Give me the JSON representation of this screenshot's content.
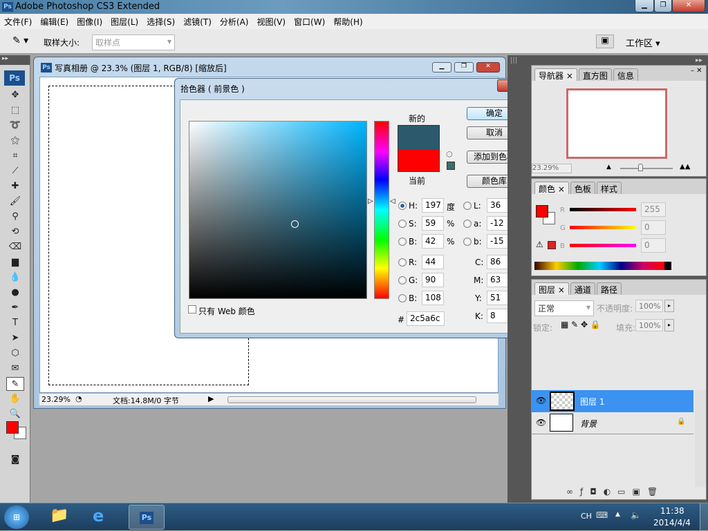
{
  "app": {
    "title": "Adobe Photoshop CS3 Extended",
    "logo": "Ps"
  },
  "menu": [
    "文件(F)",
    "编辑(E)",
    "图像(I)",
    "图层(L)",
    "选择(S)",
    "滤镜(T)",
    "分析(A)",
    "视图(V)",
    "窗口(W)",
    "帮助(H)"
  ],
  "options": {
    "sample_label": "取样大小:",
    "sample_value": "取样点",
    "workspace": "工作区 ▾"
  },
  "document": {
    "title": "写真相册 @ 23.3% (图层 1, RGB/8) [缩放后]",
    "zoom": "23.29%",
    "doc_info": "文档:14.8M/0 字节"
  },
  "picker": {
    "title": "拾色器 ( 前景色 )",
    "new_label": "新的",
    "current_label": "当前",
    "new_color": "#2c5a6c",
    "current_color": "#ff0000",
    "ok": "确定",
    "cancel": "取消",
    "add_swatch": "添加到色板",
    "libraries": "颜色库",
    "web_only": "只有 Web 颜色",
    "fields": {
      "H": {
        "label": "H:",
        "value": "197",
        "unit": "度"
      },
      "S": {
        "label": "S:",
        "value": "59",
        "unit": "%"
      },
      "Bv": {
        "label": "B:",
        "value": "42",
        "unit": "%"
      },
      "R": {
        "label": "R:",
        "value": "44"
      },
      "G": {
        "label": "G:",
        "value": "90"
      },
      "B": {
        "label": "B:",
        "value": "108"
      },
      "L": {
        "label": "L:",
        "value": "36"
      },
      "a": {
        "label": "a:",
        "value": "-12"
      },
      "b": {
        "label": "b:",
        "value": "-15"
      },
      "C": {
        "label": "C:",
        "value": "86",
        "unit": "%"
      },
      "M": {
        "label": "M:",
        "value": "63",
        "unit": "%"
      },
      "Y": {
        "label": "Y:",
        "value": "51",
        "unit": "%"
      },
      "K": {
        "label": "K:",
        "value": "8",
        "unit": "%"
      }
    },
    "hex_label": "#",
    "hex": "2c5a6c"
  },
  "navigator": {
    "tabs": [
      "导航器 ×",
      "直方图",
      "信息"
    ],
    "zoom": "23.29%"
  },
  "color_panel": {
    "tabs": [
      "颜色 ×",
      "色板",
      "样式"
    ],
    "R": {
      "label": "R",
      "value": "255"
    },
    "G": {
      "label": "G",
      "value": "0"
    },
    "B": {
      "label": "B",
      "value": "0"
    }
  },
  "layers": {
    "tabs": [
      "图层 ×",
      "通道",
      "路径"
    ],
    "blend": "正常",
    "opacity_label": "不透明度:",
    "opacity": "100%",
    "lock_label": "锁定:",
    "fill_label": "填充:",
    "fill": "100%",
    "items": [
      {
        "name": "图层 1",
        "selected": true
      },
      {
        "name": "背景",
        "locked": true
      }
    ]
  },
  "taskbar": {
    "lang": "CH",
    "time": "11:38",
    "date": "2014/4/4"
  }
}
